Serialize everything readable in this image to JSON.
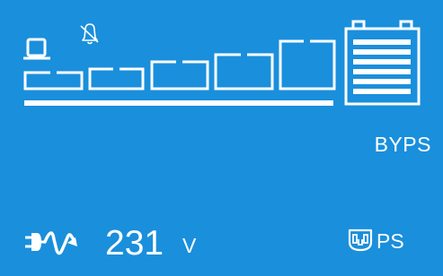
{
  "status": {
    "mode_label": "BYPS",
    "output_label": "PS"
  },
  "input": {
    "voltage_value": "231",
    "voltage_unit": "V"
  },
  "icons": {
    "computer": "computer-icon",
    "alarm": "bell-muted-icon",
    "battery": "battery-icon",
    "input_power": "ac-input-icon",
    "output_socket": "outlet-icon"
  },
  "load": {
    "segments_total": 5,
    "segments_filled": 0
  },
  "colors": {
    "background": "#1a8fdc",
    "foreground": "#ffffff"
  }
}
